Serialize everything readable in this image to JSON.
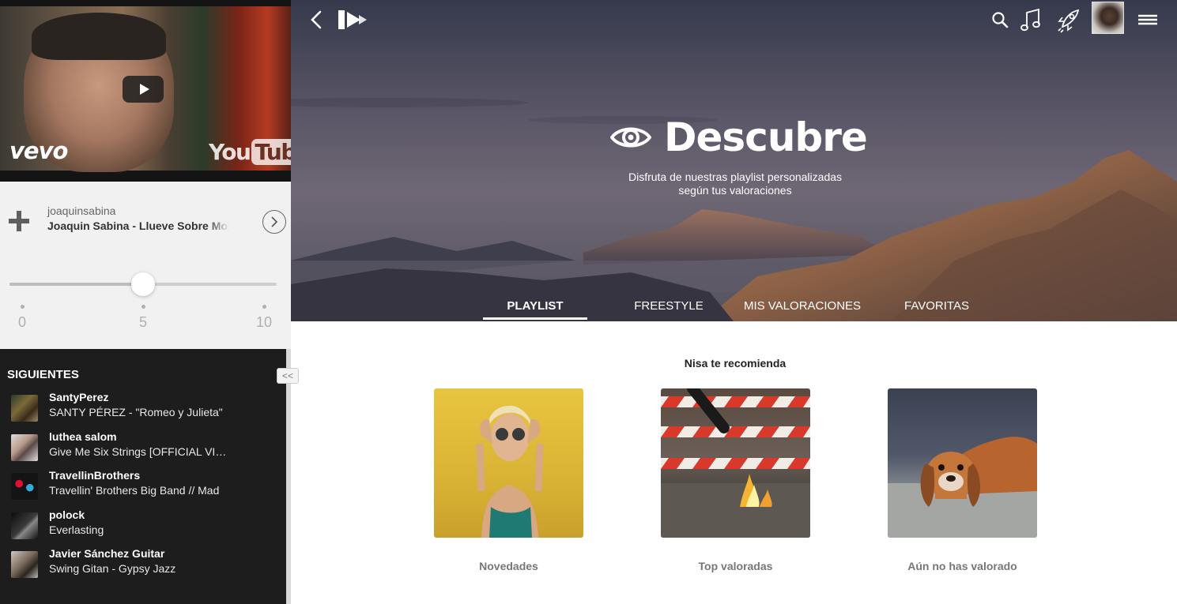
{
  "video": {
    "vevo_text": "vevo",
    "youtube_you": "You",
    "youtube_tube": "Tube"
  },
  "player": {
    "username": "joaquinsabina",
    "track_title": "Joaquin Sabina - Llueve Sobre Mojado",
    "rating_value": 5,
    "rating_min": 0,
    "rating_max": 10,
    "ticks": [
      "0",
      "5",
      "10"
    ]
  },
  "queue": {
    "heading": "SIGUIENTES",
    "collapse_icon": "double-chevron-left-icon",
    "items": [
      {
        "name": "SantyPerez",
        "song": "SANTY PÉREZ - \"Romeo y Julieta\""
      },
      {
        "name": "luthea salom",
        "song": "Give Me Six Strings [OFFICIAL VIDEO]"
      },
      {
        "name": "TravellinBrothers",
        "song": "Travellin' Brothers Big Band // Mad"
      },
      {
        "name": "polock",
        "song": "Everlasting"
      },
      {
        "name": "Javier Sánchez Guitar",
        "song": "Swing Gitan - Gypsy Jazz"
      }
    ]
  },
  "header": {
    "icons": [
      "back-icon",
      "logo-icon",
      "search-icon",
      "music-icon",
      "rocket-icon",
      "avatar",
      "menu-icon"
    ]
  },
  "hero": {
    "title": "Descubre",
    "subtitle_line1": "Disfruta de nuestras playlist personalizadas",
    "subtitle_line2": "según tus valoraciones"
  },
  "tabs": [
    {
      "label": "PLAYLIST",
      "active": true
    },
    {
      "label": "FREESTYLE",
      "active": false
    },
    {
      "label": "MIS VALORACIONES",
      "active": false
    },
    {
      "label": "FAVORITAS",
      "active": false
    }
  ],
  "recommend": {
    "heading": "Nisa te recomienda",
    "cards": [
      {
        "label": "Novedades"
      },
      {
        "label": "Top valoradas"
      },
      {
        "label": "Aún no has valorado"
      }
    ]
  },
  "colors": {
    "queue_bg": "#1d1d1d",
    "player_bg": "#f1f1f1",
    "card_label": "#777777"
  }
}
